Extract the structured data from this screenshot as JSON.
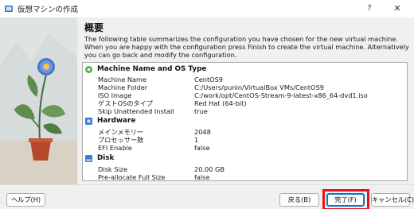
{
  "window": {
    "title": "仮想マシンの作成",
    "help_glyph": "?",
    "close_glyph": "✕"
  },
  "page": {
    "title": "概要",
    "description_lines": [
      "The following table summarizes the configuration you have chosen for the new virtual machine.",
      "When you are happy with the configuration press Finish to create the virtual machine. Alternatively",
      "you can go back and modify the configuration."
    ]
  },
  "summary": {
    "machine": {
      "label": "Machine Name and OS Type",
      "rows": [
        {
          "key": "Machine Name",
          "value": "CentOS9"
        },
        {
          "key": "Machine Folder",
          "value": "C:/Users/punin/VirtualBox VMs/CentOS9"
        },
        {
          "key": "ISO Image",
          "value": "C:/work/opt/CentOS-Stream-9-latest-x86_64-dvd1.iso"
        },
        {
          "key": "ゲストOSのタイプ",
          "value": "Red Hat (64-bit)"
        },
        {
          "key": "Skip Unattended Install",
          "value": "true"
        }
      ]
    },
    "hardware": {
      "label": "Hardware",
      "rows": [
        {
          "key": "メインメモリー",
          "value": "2048"
        },
        {
          "key": "プロセッサー数",
          "value": "1"
        },
        {
          "key": "EFI Enable",
          "value": "false"
        }
      ]
    },
    "disk": {
      "label": "Disk",
      "rows": [
        {
          "key": "Disk Size",
          "value": "20.00 GB"
        },
        {
          "key": "Pre-allocate Full Size",
          "value": "false"
        }
      ]
    }
  },
  "buttons": {
    "help": "ヘルプ(H)",
    "back": "戻る(B)",
    "finish": "完了(F)",
    "cancel": "キャンセル(C)"
  },
  "colors": {
    "accent": "#0078d4",
    "highlight": "#e3121b",
    "section_icon": "#3a7bd5",
    "machine_icon": "#4caf50"
  }
}
